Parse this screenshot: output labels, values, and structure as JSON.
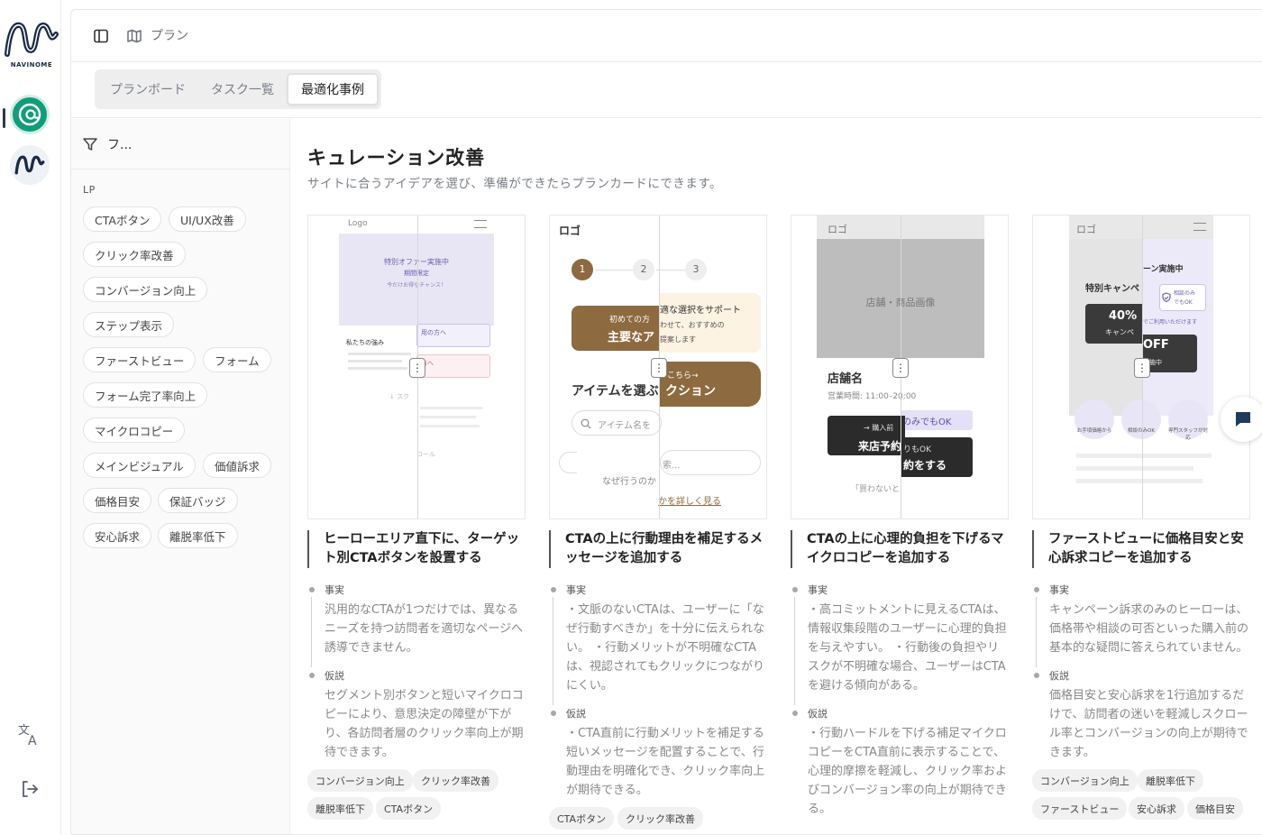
{
  "app": {
    "logo_text": "NAVINOME"
  },
  "topbar": {
    "breadcrumb": "プラン"
  },
  "tabs": [
    {
      "label": "プランボード",
      "selected": false
    },
    {
      "label": "タスク一覧",
      "selected": false
    },
    {
      "label": "最適化事例",
      "selected": true
    }
  ],
  "sidebar": {
    "filter_label": "フ...",
    "group_label": "LP",
    "chips": [
      "CTAボタン",
      "UI/UX改善",
      "クリック率改善",
      "コンバージョン向上",
      "ステップ表示",
      "ファーストビュー",
      "フォーム",
      "フォーム完了率向上",
      "マイクロコピー",
      "メインビジュアル",
      "価値訴求",
      "価格目安",
      "保証バッジ",
      "安心訴求",
      "離脱率低下"
    ]
  },
  "content": {
    "title": "キュレーション改善",
    "subtitle": "サイトに合うアイデアを選び、準備ができたらプランカードにできます。",
    "cards": [
      {
        "title": "ヒーローエリア直下に、ターゲット別CTAボタンを設置する",
        "fact_label": "事実",
        "fact": "汎用的なCTAが1つだけでは、異なるニーズを持つ訪問者を適切なページへ誘導できません。",
        "hyp_label": "仮説",
        "hypothesis": "セグメント別ボタンと短いマイクロコピーにより、意思決定の障壁が下がり、各訪問者層のクリック率向上が期待できます。",
        "tags": [
          "コンバージョン向上",
          "クリック率改善",
          "離脱率低下",
          "CTAボタン"
        ],
        "mock": {
          "logo": "Logo",
          "banner1": "特別オファー実施中",
          "banner2": "期間限定",
          "banner3": "今だけお得なチャンス！",
          "strength": "私たちの強み",
          "b1": "用の方へ",
          "b2": "方へ",
          "scroll": "↓ スク",
          "foot": "ロール"
        }
      },
      {
        "title": "CTAの上に行動理由を補足するメッセージを追加する",
        "fact_label": "事実",
        "fact": "・文脈のないCTAは、ユーザーに「なぜ行動すべきか」を十分に伝えられない。 ・行動メリットが不明確なCTAは、視認されてもクリックにつながりにくい。",
        "hyp_label": "仮説",
        "hypothesis": "・CTA直前に行動メリットを補足する短いメッセージを配置することで、行動理由を明確化でき、クリック率向上が期待できる。",
        "tags": [
          "CTAボタン",
          "クリック率改善"
        ],
        "mock": {
          "logo": "ロゴ",
          "s1": "1",
          "s2": "2",
          "s3": "3",
          "l1": "初めての方",
          "l2": "主要なア",
          "r1": "適な選択をサポート",
          "r2": "わせて、おすすめの",
          "r3": "提案します",
          "cta_r": "こちら→",
          "big_l": "アイテムを選ぶ",
          "big_r": "クション",
          "search": "アイテム名を",
          "why": "なぜ行うのか",
          "dots": "索...",
          "more": "かを詳しく見る"
        }
      },
      {
        "title": "CTAの上に心理的負担を下げるマイクロコピーを追加する",
        "fact_label": "事実",
        "fact": "・高コミットメントに見えるCTAは、情報収集段階のユーザーに心理的負担を与えやすい。 ・行動後の負担やリスクが不明確な場合、ユーザーはCTAを避ける傾向がある。",
        "hyp_label": "仮説",
        "hypothesis": "・行動ハードルを下げる補足マイクロコピーをCTA直前に表示することで、心理的摩擦を軽減し、クリック率およびコンバージョン率の向上が期待できる。",
        "tags": [],
        "mock": {
          "logo": "ロゴ",
          "img": "店舗・商品画像",
          "shop": "店舗名",
          "hours": "営業時間: 11:00–20:00",
          "r_tag": "のみでもOK",
          "l_pre": "→ 購入前",
          "l_btn": "来店予約",
          "r_mid": "りもOK",
          "r_btn": "約をする",
          "foot": "「買わないと"
        }
      },
      {
        "title": "ファーストビューに価格目安と安心訴求コピーを追加する",
        "fact_label": "事実",
        "fact": "キャンペーン訴求のみのヒーローは、価格帯や相談の可否といった購入前の基本的な疑問に答えられていません。",
        "hyp_label": "仮説",
        "hypothesis": "価格目安と安心訴求を1行追加するだけで、訪問者の迷いを軽減しスクロール率とコンバージョンの向上が期待できます。",
        "tags": [
          "コンバージョン向上",
          "離脱率低下",
          "ファーストビュー",
          "安心訴求",
          "価格目安"
        ],
        "mock": {
          "logo": "ロゴ",
          "l_head": "特別キャンペ",
          "r_head": "ーン実施中",
          "pct": "40%",
          "l_sub": "キャンペ",
          "off": "OFF",
          "r_sub": "実施中",
          "badge1": "相談のみ",
          "badge2": "でもOK",
          "note": "でご利用いただけます",
          "i1": "お手頃価格から",
          "i2": "相談のみOK",
          "i3": "専門スタッフが対応"
        }
      }
    ]
  },
  "colors": {
    "accent_brown": "#8d6a3f",
    "teal": "#0f9d7a",
    "dark": "#2b2b2b",
    "lavender": "#e8e6f5"
  }
}
